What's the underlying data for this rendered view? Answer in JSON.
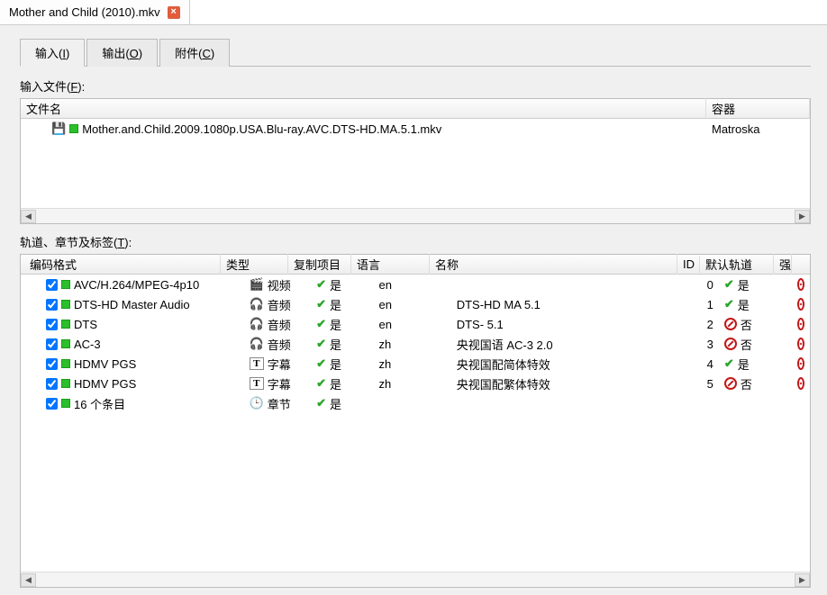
{
  "doc_tab": {
    "title": "Mother and Child (2010).mkv"
  },
  "tabs": [
    {
      "pre": "输入(",
      "u": "I",
      "post": ")"
    },
    {
      "pre": "输出(",
      "u": "O",
      "post": ")"
    },
    {
      "pre": "附件(",
      "u": "C",
      "post": ")"
    }
  ],
  "labels": {
    "input_files_pre": "输入文件(",
    "input_files_u": "F",
    "input_files_post": "):",
    "tracks_pre": "轨道、章节及标签(",
    "tracks_u": "T",
    "tracks_post": "):"
  },
  "files": {
    "headers": {
      "name": "文件名",
      "container": "容器"
    },
    "rows": [
      {
        "name": "Mother.and.Child.2009.1080p.USA.Blu-ray.AVC.DTS-HD.MA.5.1.mkv",
        "container": "Matroska"
      }
    ]
  },
  "tracks": {
    "headers": {
      "codec": "编码格式",
      "type": "类型",
      "copy": "复制项目",
      "lang": "语言",
      "name": "名称",
      "id": "ID",
      "def": "默认轨道",
      "forced": "强"
    },
    "type_icons": {
      "video": "🎬",
      "audio": "🎧",
      "subtitle": "T",
      "chapters": "🕒"
    },
    "type_text": {
      "video": "视频",
      "audio": "音频",
      "subtitle": "字幕",
      "chapters": "章节"
    },
    "yes": "是",
    "no": "否",
    "rows": [
      {
        "checked": true,
        "codec": "AVC/H.264/MPEG-4p10",
        "type": "video",
        "copy": true,
        "lang": "en",
        "name": "",
        "id": "0",
        "def": true
      },
      {
        "checked": true,
        "codec": "DTS-HD Master Audio",
        "type": "audio",
        "copy": true,
        "lang": "en",
        "name": "DTS-HD MA 5.1",
        "id": "1",
        "def": true
      },
      {
        "checked": true,
        "codec": "DTS",
        "type": "audio",
        "copy": true,
        "lang": "en",
        "name": "DTS- 5.1",
        "id": "2",
        "def": false
      },
      {
        "checked": true,
        "codec": "AC-3",
        "type": "audio",
        "copy": true,
        "lang": "zh",
        "name": "央视国语 AC-3 2.0",
        "id": "3",
        "def": false
      },
      {
        "checked": true,
        "codec": "HDMV PGS",
        "type": "subtitle",
        "copy": true,
        "lang": "zh",
        "name": "央视国配简体特效",
        "id": "4",
        "def": true
      },
      {
        "checked": true,
        "codec": "HDMV PGS",
        "type": "subtitle",
        "copy": true,
        "lang": "zh",
        "name": "央视国配繁体特效",
        "id": "5",
        "def": false
      },
      {
        "checked": true,
        "codec": "16 个条目",
        "type": "chapters",
        "copy": true,
        "lang": "",
        "name": "",
        "id": "",
        "def": null
      }
    ]
  }
}
